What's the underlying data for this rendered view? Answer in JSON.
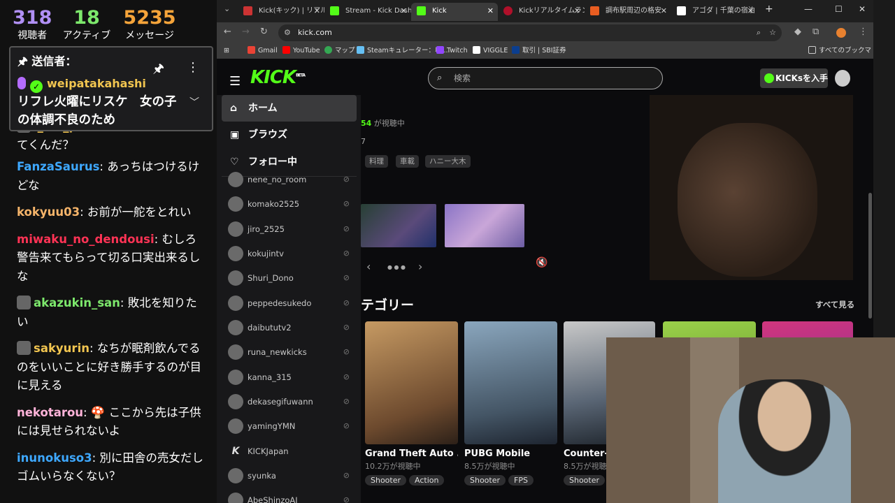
{
  "stats": [
    {
      "value": "318",
      "label": "視聴者"
    },
    {
      "value": "18",
      "label": "アクティブ"
    },
    {
      "value": "5235",
      "label": "メッセージ"
    }
  ],
  "pinned": {
    "title": "送信者：",
    "sender": "weipatakahashi",
    "text": "リフレ火曜にリスケ　女の子の体調不良のため"
  },
  "chat": [
    {
      "user": "i_am_pon",
      "text": "コムはなんだと行ってくんだ？",
      "color": "#f1c550"
    },
    {
      "user": "FanzaSaurus",
      "text": "あっちはつけるけどな",
      "color": "#3ea8ff"
    },
    {
      "user": "kokyuu03",
      "text": "お前が一舵をとれい",
      "color": "#f5b46a"
    },
    {
      "user": "miwaku_no_dendousi",
      "text": "むしろ警告来てもらって切る口実出来るしな",
      "color": "#ff3355"
    },
    {
      "user": "akazukin_san",
      "text": "敗北を知りたい",
      "color": "#7de86c"
    },
    {
      "user": "sakyurin",
      "text": "なちが眠剤飲んでるのをいいことに好き勝手するのが目に見える",
      "color": "#f1c550"
    },
    {
      "user": "nekotarou",
      "text": "🍄 ここから先は子供には見せられないよ",
      "color": "#ffb3d9"
    },
    {
      "user": "inunokuso3",
      "text": "別に田舎の売女だしゴムいらなくない？",
      "color": "#3ea8ff"
    }
  ],
  "browser": {
    "tabs": [
      {
        "title": "Kick(キック) | リアルタ",
        "fav": "#c33"
      },
      {
        "title": "Stream - Kick Dash",
        "fav": "#53fc18"
      },
      {
        "title": "Kick",
        "fav": "#53fc18"
      },
      {
        "title": "Kickリアルタイムラン",
        "fav": "#b0102a"
      },
      {
        "title": "調布駅周辺の格安",
        "fav": "#e85d21"
      },
      {
        "title": "アゴダ | 千葉の宿泊",
        "fav": "#ffffff"
      }
    ],
    "url": "kick.com",
    "bookmarks": [
      "Gmail",
      "YouTube",
      "マップ",
      "Steamキュレーター：収...",
      "Twitch",
      "VIGGLE",
      "取引 | SBI証券"
    ],
    "bookmarks_all": "すべてのブックマーク"
  },
  "site": {
    "search_placeholder": "検索",
    "kicks_button": "KICKsを入手",
    "nav": [
      "ホーム",
      "ブラウズ",
      "フォロー中"
    ],
    "channels": [
      "nene_no_room",
      "komako2525",
      "jiro_2525",
      "kokujintv",
      "Shuri_Dono",
      "peppedesukedo",
      "daibututv2",
      "runa_newkicks",
      "kanna_315",
      "dekasegifuwann",
      "yamingYMN",
      "KICKJapan",
      "syunka",
      "AbeShinzoAI"
    ],
    "viewers_count": "54",
    "viewers_suffix": " が視聴中",
    "stray_char": "7",
    "chips": [
      "料理",
      "車載",
      "ハニー大木"
    ],
    "section_title": "テゴリー",
    "see_all": "すべて見る",
    "categories": [
      {
        "name": "Grand Theft Auto ...",
        "viewers": "10.2万が視聴中",
        "tags": [
          "Shooter",
          "Action"
        ],
        "color": "#a47a4c"
      },
      {
        "name": "PUBG Mobile",
        "viewers": "8.5万が視聴中",
        "tags": [
          "Shooter",
          "FPS"
        ],
        "color": "#5a7083"
      },
      {
        "name": "Counter-S",
        "viewers": "8.5万が視聴",
        "tags": [
          "Shooter"
        ],
        "color": "#3a4452"
      }
    ]
  }
}
